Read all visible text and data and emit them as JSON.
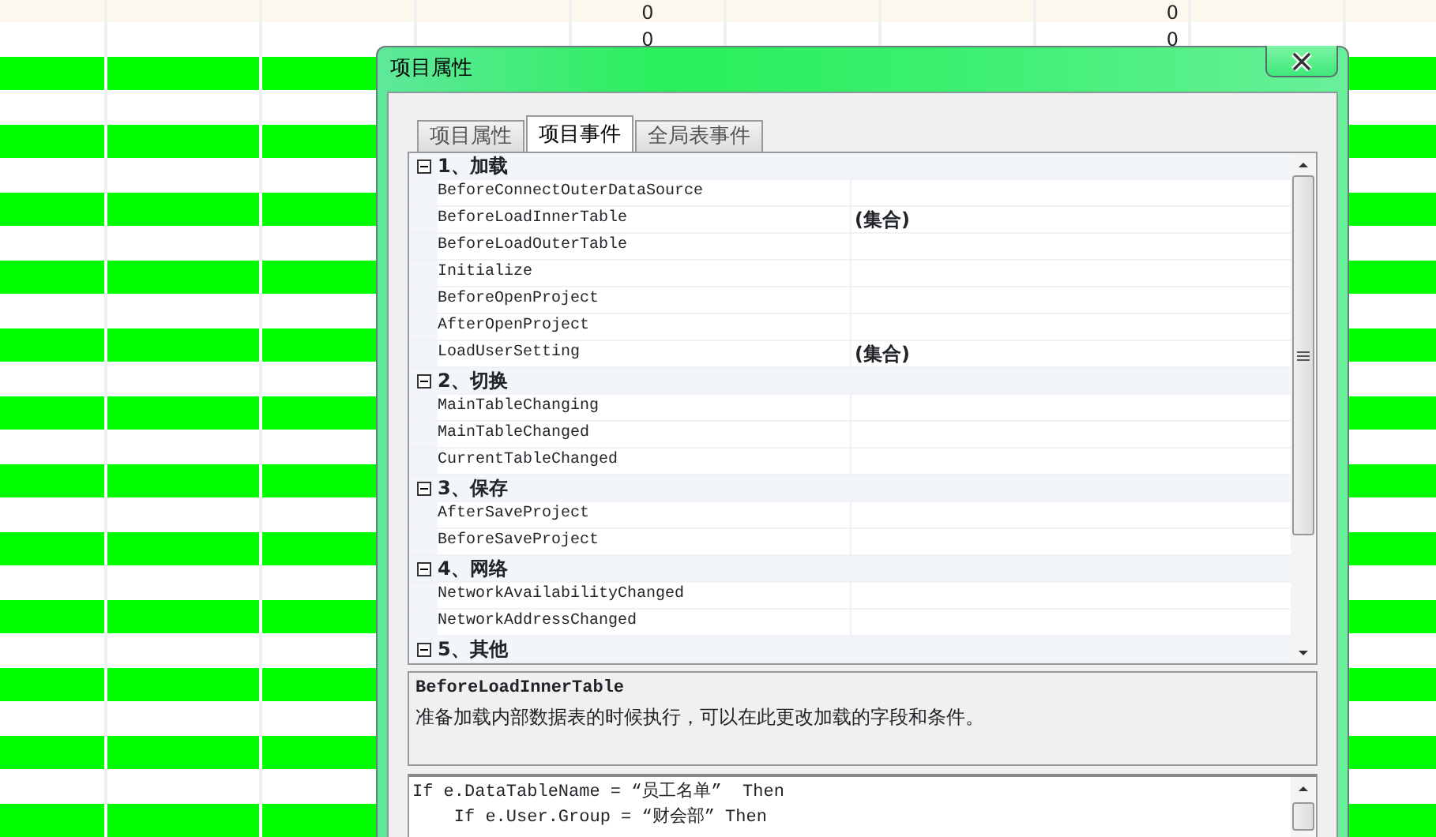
{
  "sheet": {
    "rows": [
      {
        "kind": "header",
        "cells": {
          "column_5": "0",
          "column_8": "0"
        }
      },
      {
        "kind": "plain",
        "cells": {
          "column_5": "0",
          "column_8": "0"
        }
      },
      {
        "kind": "highlighted"
      },
      {
        "kind": "plain"
      },
      {
        "kind": "highlighted"
      },
      {
        "kind": "plain"
      },
      {
        "kind": "highlighted"
      },
      {
        "kind": "plain"
      },
      {
        "kind": "highlighted"
      },
      {
        "kind": "plain"
      },
      {
        "kind": "highlighted"
      },
      {
        "kind": "plain"
      },
      {
        "kind": "highlighted"
      },
      {
        "kind": "plain"
      },
      {
        "kind": "highlighted"
      },
      {
        "kind": "plain"
      },
      {
        "kind": "highlighted"
      },
      {
        "kind": "plain"
      },
      {
        "kind": "highlighted"
      },
      {
        "kind": "plain"
      },
      {
        "kind": "highlighted"
      },
      {
        "kind": "plain"
      },
      {
        "kind": "highlighted"
      },
      {
        "kind": "plain"
      },
      {
        "kind": "highlighted"
      }
    ]
  },
  "dialog": {
    "title": "项目属性",
    "tabs": [
      {
        "label": "项目属性",
        "selected": false
      },
      {
        "label": "项目事件",
        "selected": true
      },
      {
        "label": "全局表事件",
        "selected": false
      }
    ],
    "property_grid": {
      "categories": [
        {
          "title": "1、加载",
          "expanded": true,
          "items": [
            {
              "name": "BeforeConnectOuterDataSource"
            },
            {
              "name": "BeforeLoadInnerTable",
              "value": "(集合)"
            },
            {
              "name": "BeforeLoadOuterTable"
            },
            {
              "name": "Initialize"
            },
            {
              "name": "BeforeOpenProject"
            },
            {
              "name": "AfterOpenProject"
            },
            {
              "name": "LoadUserSetting",
              "value": "(集合)"
            }
          ]
        },
        {
          "title": "2、切换",
          "expanded": true,
          "items": [
            {
              "name": "MainTableChanging"
            },
            {
              "name": "MainTableChanged"
            },
            {
              "name": "CurrentTableChanged"
            }
          ]
        },
        {
          "title": "3、保存",
          "expanded": true,
          "items": [
            {
              "name": "AfterSaveProject"
            },
            {
              "name": "BeforeSaveProject"
            }
          ]
        },
        {
          "title": "4、网络",
          "expanded": true,
          "items": [
            {
              "name": "NetworkAvailabilityChanged"
            },
            {
              "name": "NetworkAddressChanged"
            }
          ]
        },
        {
          "title": "5、其他",
          "expanded": true
        }
      ]
    },
    "description": {
      "title": "BeforeLoadInnerTable",
      "text": "准备加载内部数据表的时候执行，可以在此更改加载的字段和条件。"
    },
    "code": {
      "lines": [
        "If e.DataTableName = “员工名单”  Then",
        "    If e.User.Group = “财会部” Then"
      ]
    }
  }
}
